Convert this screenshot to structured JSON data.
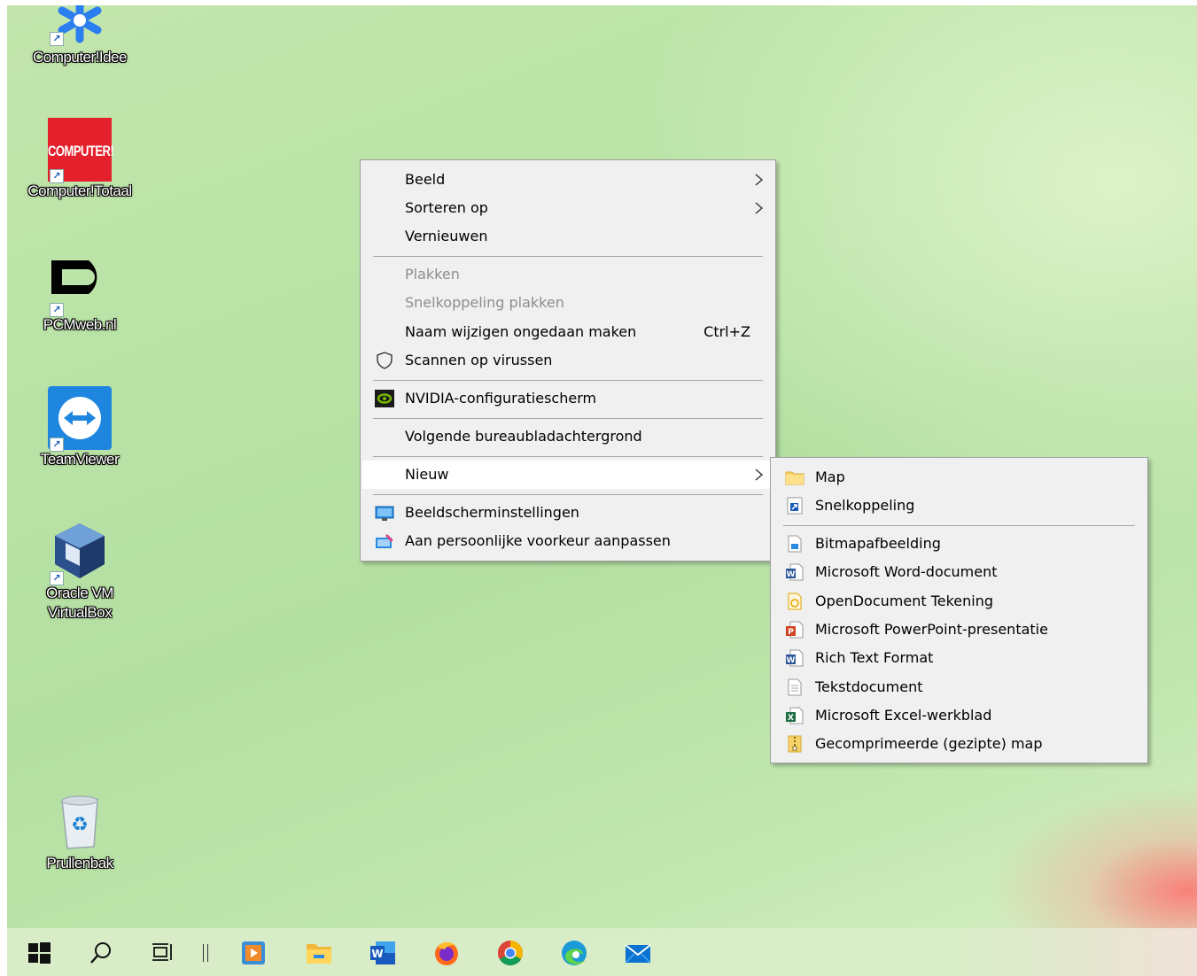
{
  "desktop_icons": [
    {
      "label": "Computer!Idee",
      "icon": "snowflake-logo-icon"
    },
    {
      "label": "Computer!Totaal",
      "icon": "computer-totaal-logo-icon",
      "logo_text": "COMPUTER!"
    },
    {
      "label": "PCMweb.nl",
      "icon": "pcmweb-logo-icon"
    },
    {
      "label": "TeamViewer",
      "icon": "teamviewer-icon"
    },
    {
      "label": "Oracle VM VirtualBox",
      "icon": "virtualbox-icon"
    },
    {
      "label": "Prullenbak",
      "icon": "recycle-bin-icon"
    }
  ],
  "context_menu": {
    "items": [
      {
        "label": "Beeld",
        "submenu": true
      },
      {
        "label": "Sorteren op",
        "submenu": true
      },
      {
        "label": "Vernieuwen"
      },
      {
        "label": "Plakken",
        "disabled": true
      },
      {
        "label": "Snelkoppeling plakken",
        "disabled": true
      },
      {
        "label": "Naam wijzigen ongedaan maken",
        "shortcut": "Ctrl+Z"
      },
      {
        "label": "Scannen op virussen",
        "icon": "shield-icon"
      },
      {
        "label": "NVIDIA-configuratiescherm",
        "icon": "nvidia-icon"
      },
      {
        "label": "Volgende bureaubladachtergrond"
      },
      {
        "label": "Nieuw",
        "submenu": true,
        "highlighted": true
      },
      {
        "label": "Beeldscherminstellingen",
        "icon": "display-settings-icon"
      },
      {
        "label": "Aan persoonlijke voorkeur aanpassen",
        "icon": "personalize-icon"
      }
    ]
  },
  "new_submenu": {
    "items": [
      {
        "label": "Map",
        "icon": "folder-icon"
      },
      {
        "label": "Snelkoppeling",
        "icon": "shortcut-icon"
      },
      {
        "label": "Bitmapafbeelding",
        "icon": "bitmap-file-icon"
      },
      {
        "label": "Microsoft Word-document",
        "icon": "word-doc-icon"
      },
      {
        "label": "OpenDocument Tekening",
        "icon": "odg-file-icon"
      },
      {
        "label": "Microsoft PowerPoint-presentatie",
        "icon": "powerpoint-file-icon"
      },
      {
        "label": "Rich Text Format",
        "icon": "rtf-file-icon"
      },
      {
        "label": "Tekstdocument",
        "icon": "text-file-icon"
      },
      {
        "label": "Microsoft Excel-werkblad",
        "icon": "excel-file-icon"
      },
      {
        "label": "Gecomprimeerde (gezipte) map",
        "icon": "zip-folder-icon"
      }
    ]
  },
  "taskbar": {
    "items": [
      "start-icon",
      "search-icon",
      "task-view-icon",
      "media-player-icon",
      "file-explorer-icon",
      "word-icon",
      "firefox-icon",
      "chrome-icon",
      "edge-icon",
      "mail-icon"
    ]
  },
  "colors": {
    "menu_bg": "#f0f0f0",
    "menu_highlight": "#ffffff",
    "desktop_green": "#b9e3a6"
  }
}
